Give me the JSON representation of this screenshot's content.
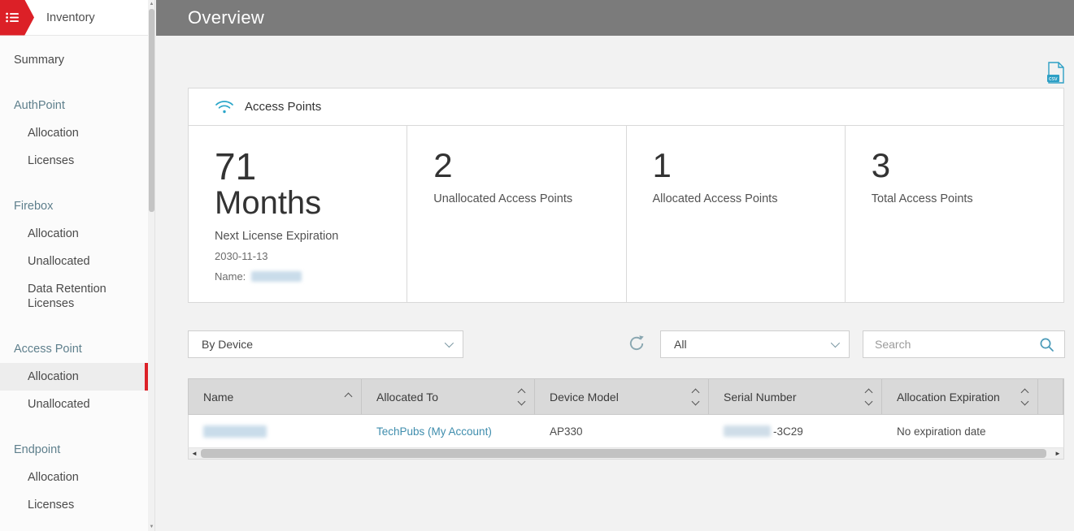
{
  "colors": {
    "brand_red": "#dc2027",
    "topbar_gray": "#7b7b7b",
    "teal": "#2ba6c9",
    "link_blue": "#3f8dad"
  },
  "sidebar": {
    "title": "Inventory",
    "items": [
      {
        "label": "Summary"
      }
    ],
    "groups": [
      {
        "header": "AuthPoint",
        "children": [
          {
            "label": "Allocation"
          },
          {
            "label": "Licenses"
          }
        ]
      },
      {
        "header": "Firebox",
        "children": [
          {
            "label": "Allocation"
          },
          {
            "label": "Unallocated"
          },
          {
            "label": "Data Retention Licenses"
          }
        ]
      },
      {
        "header": "Access Point",
        "children": [
          {
            "label": "Allocation",
            "selected": true
          },
          {
            "label": "Unallocated"
          }
        ]
      },
      {
        "header": "Endpoint",
        "children": [
          {
            "label": "Allocation"
          },
          {
            "label": "Licenses"
          }
        ]
      }
    ]
  },
  "topbar": {
    "title": "Overview"
  },
  "toolbar": {
    "csv_export_label": "csv"
  },
  "card": {
    "title": "Access Points",
    "stats": [
      {
        "value": "71",
        "unit": "Months",
        "label": "Next License Expiration",
        "date": "2030-11-13",
        "name_label": "Name:",
        "name_redacted": true
      },
      {
        "value": "2",
        "label": "Unallocated Access Points"
      },
      {
        "value": "1",
        "label": "Allocated Access Points"
      },
      {
        "value": "3",
        "label": "Total Access Points"
      }
    ]
  },
  "filters": {
    "group_by_value": "By Device",
    "filter_value": "All",
    "search_placeholder": "Search"
  },
  "table": {
    "columns": [
      {
        "label": "Name",
        "sort": "asc"
      },
      {
        "label": "Allocated To",
        "sort": "none"
      },
      {
        "label": "Device Model",
        "sort": "none"
      },
      {
        "label": "Serial Number",
        "sort": "none"
      },
      {
        "label": "Allocation Expiration",
        "sort": "none"
      }
    ],
    "rows": [
      {
        "name_redacted": true,
        "allocated_to": "TechPubs (My Account)",
        "device_model": "AP330",
        "serial_redacted": true,
        "serial_visible": "-3C29",
        "allocation_expiration": "No expiration date"
      }
    ]
  }
}
